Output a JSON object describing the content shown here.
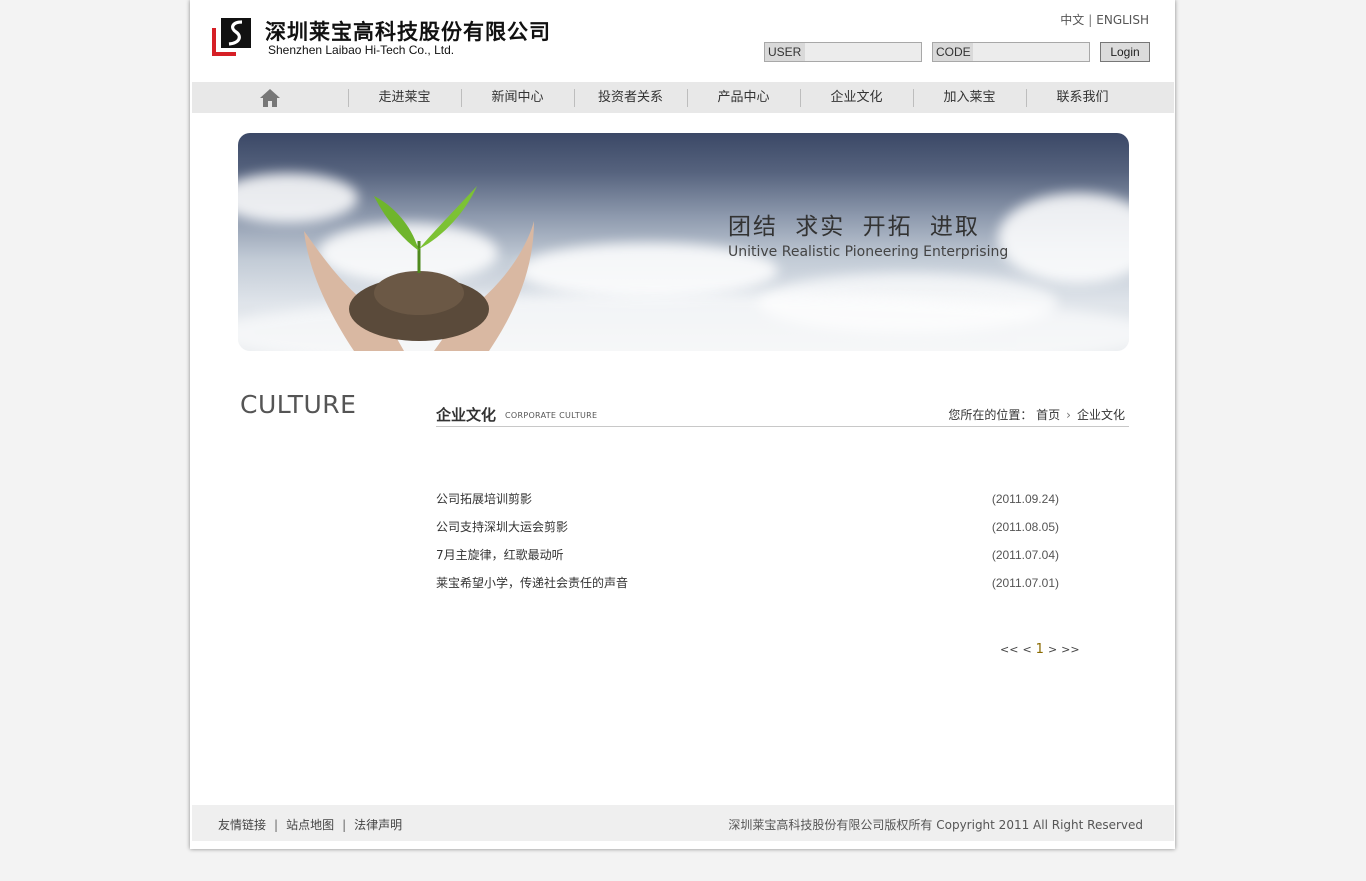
{
  "header": {
    "logo_cn": "深圳莱宝高科技股份有限公司",
    "logo_en": "Shenzhen Laibao Hi-Tech Co., Ltd.",
    "lang": {
      "cn": "中文",
      "sep": "|",
      "en": "ENGLISH"
    },
    "login": {
      "user_label": "USER",
      "code_label": "CODE",
      "button": "Login"
    }
  },
  "nav": {
    "home_icon": "home-icon",
    "items": [
      "走进莱宝",
      "新闻中心",
      "投资者关系",
      "产品中心",
      "企业文化",
      "加入莱宝",
      "联系我们"
    ]
  },
  "banner": {
    "title_cn": "团结 求实 开拓 进取",
    "title_en": "Unitive Realistic Pioneering Enterprising"
  },
  "sidebar": {
    "title": "CULTURE"
  },
  "content": {
    "title": "企业文化",
    "subtitle": "CORPORATE CULTURE",
    "breadcrumb": {
      "prefix": "您所在的位置：",
      "home": "首页",
      "current": "企业文化"
    },
    "news": [
      {
        "title": "公司拓展培训剪影",
        "date": "(2011.09.24)"
      },
      {
        "title": "公司支持深圳大运会剪影",
        "date": "(2011.08.05)"
      },
      {
        "title": "7月主旋律，红歌最动听",
        "date": "(2011.07.04)"
      },
      {
        "title": "莱宝希望小学，传递社会责任的声音",
        "date": "(2011.07.01)"
      }
    ],
    "pager": {
      "first": "<<",
      "prev": "<",
      "current": "1",
      "next": ">",
      "last": ">>"
    }
  },
  "footer": {
    "links": [
      "友情链接",
      "站点地图",
      "法律声明"
    ],
    "link_sep": "|",
    "copyright": "深圳莱宝高科技股份有限公司版权所有 Copyright 2011 All Right Reserved"
  },
  "colors": {
    "brand_red": "#d61f26",
    "nav_bg": "#e8e8e8",
    "footer_bg": "#efefef"
  }
}
